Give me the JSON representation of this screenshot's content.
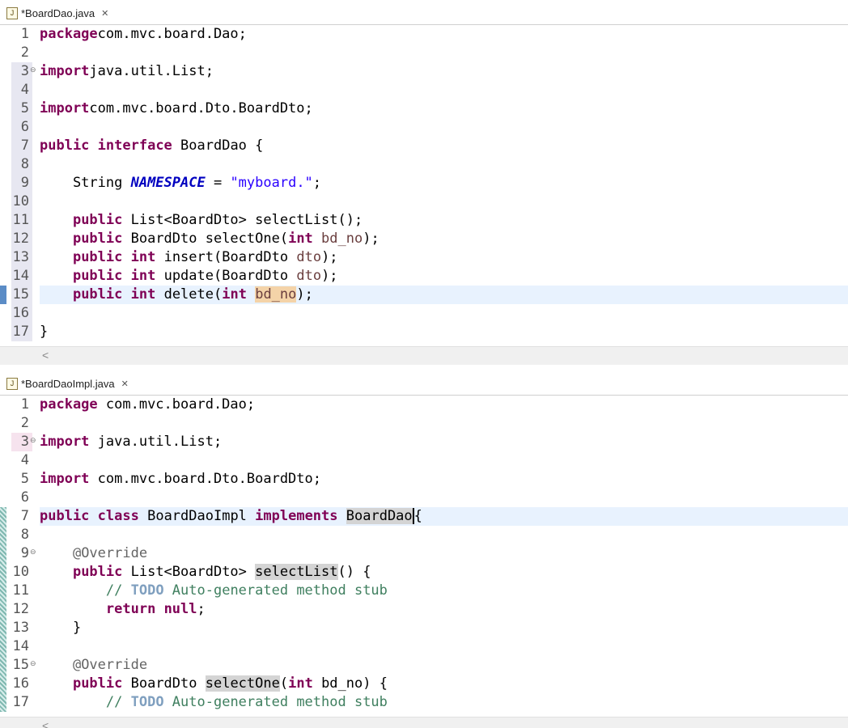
{
  "editors": [
    {
      "tab_label": "*BoardDao.java",
      "lines": [
        {
          "n": "1",
          "segs": [
            [
              "kw",
              "package"
            ],
            [
              "",
              "com.mvc.board.Dao;"
            ]
          ]
        },
        {
          "n": "2",
          "segs": []
        },
        {
          "n": "3",
          "segs": [
            [
              "kw",
              "import"
            ],
            [
              "",
              "java.util.List;"
            ]
          ]
        },
        {
          "n": "4",
          "segs": []
        },
        {
          "n": "5",
          "segs": [
            [
              "kw",
              "import"
            ],
            [
              "",
              "com.mvc.board.Dto.BoardDto;"
            ]
          ]
        },
        {
          "n": "6",
          "segs": []
        },
        {
          "n": "7",
          "segs": [
            [
              "kw",
              "public"
            ],
            [
              "",
              " "
            ],
            [
              "kw",
              "interface"
            ],
            [
              "",
              " BoardDao {"
            ]
          ]
        },
        {
          "n": "8",
          "segs": []
        },
        {
          "n": "9",
          "segs": [
            [
              "",
              "    String "
            ],
            [
              "const",
              "NAMESPACE"
            ],
            [
              "",
              " = "
            ],
            [
              "str",
              "\"myboard.\""
            ],
            [
              "",
              ";"
            ]
          ]
        },
        {
          "n": "10",
          "segs": []
        },
        {
          "n": "11",
          "segs": [
            [
              "",
              "    "
            ],
            [
              "kw",
              "public"
            ],
            [
              "",
              " List<BoardDto> selectList();"
            ]
          ]
        },
        {
          "n": "12",
          "segs": [
            [
              "",
              "    "
            ],
            [
              "kw",
              "public"
            ],
            [
              "",
              " BoardDto selectOne("
            ],
            [
              "kw",
              "int"
            ],
            [
              "",
              " "
            ],
            [
              "param",
              "bd_no"
            ],
            [
              "",
              ");"
            ]
          ]
        },
        {
          "n": "13",
          "segs": [
            [
              "",
              "    "
            ],
            [
              "kw",
              "public"
            ],
            [
              "",
              " "
            ],
            [
              "kw",
              "int"
            ],
            [
              "",
              " insert(BoardDto "
            ],
            [
              "param",
              "dto"
            ],
            [
              "",
              ");"
            ]
          ]
        },
        {
          "n": "14",
          "segs": [
            [
              "",
              "    "
            ],
            [
              "kw",
              "public"
            ],
            [
              "",
              " "
            ],
            [
              "kw",
              "int"
            ],
            [
              "",
              " update(BoardDto "
            ],
            [
              "param",
              "dto"
            ],
            [
              "",
              ");"
            ]
          ]
        },
        {
          "n": "15",
          "segs": [
            [
              "",
              "    "
            ],
            [
              "kw",
              "public"
            ],
            [
              "",
              " "
            ],
            [
              "kw",
              "int"
            ],
            [
              "",
              " delete("
            ],
            [
              "kw",
              "int"
            ],
            [
              "",
              " "
            ],
            [
              "param occp",
              "bd_no"
            ],
            [
              "",
              ");"
            ]
          ]
        },
        {
          "n": "16",
          "segs": []
        },
        {
          "n": "17",
          "segs": [
            [
              "",
              "}"
            ]
          ]
        }
      ]
    },
    {
      "tab_label": "*BoardDaoImpl.java",
      "lines": [
        {
          "n": "1",
          "segs": [
            [
              "kw",
              "package"
            ],
            [
              "",
              " com.mvc.board.Dao;"
            ]
          ]
        },
        {
          "n": "2",
          "segs": []
        },
        {
          "n": "3",
          "segs": [
            [
              "kw",
              "import"
            ],
            [
              "",
              " java.util.List;"
            ]
          ]
        },
        {
          "n": "4",
          "segs": []
        },
        {
          "n": "5",
          "segs": [
            [
              "kw",
              "import"
            ],
            [
              "",
              " com.mvc.board.Dto.BoardDto;"
            ]
          ]
        },
        {
          "n": "6",
          "segs": []
        },
        {
          "n": "7",
          "segs": [
            [
              "kw",
              "public"
            ],
            [
              "",
              " "
            ],
            [
              "kw",
              "class"
            ],
            [
              "",
              " BoardDaoImpl "
            ],
            [
              "kw",
              "implements"
            ],
            [
              "",
              " "
            ],
            [
              "occ caret",
              "BoardDao"
            ],
            [
              "",
              "{"
            ]
          ]
        },
        {
          "n": "8",
          "segs": []
        },
        {
          "n": "9",
          "segs": [
            [
              "",
              "    "
            ],
            [
              "ann",
              "@Override"
            ]
          ]
        },
        {
          "n": "10",
          "segs": [
            [
              "",
              "    "
            ],
            [
              "kw",
              "public"
            ],
            [
              "",
              " List<BoardDto> "
            ],
            [
              "occ",
              "selectList"
            ],
            [
              "",
              "() {"
            ]
          ]
        },
        {
          "n": "11",
          "segs": [
            [
              "",
              "        "
            ],
            [
              "cmt",
              "// "
            ],
            [
              "todo",
              "TODO"
            ],
            [
              "cmt",
              " Auto-generated method stub"
            ]
          ]
        },
        {
          "n": "12",
          "segs": [
            [
              "",
              "        "
            ],
            [
              "kw",
              "return"
            ],
            [
              "",
              " "
            ],
            [
              "kw",
              "null"
            ],
            [
              "",
              ";"
            ]
          ]
        },
        {
          "n": "13",
          "segs": [
            [
              "",
              "    }"
            ]
          ]
        },
        {
          "n": "14",
          "segs": []
        },
        {
          "n": "15",
          "segs": [
            [
              "",
              "    "
            ],
            [
              "ann",
              "@Override"
            ]
          ]
        },
        {
          "n": "16",
          "segs": [
            [
              "",
              "    "
            ],
            [
              "kw",
              "public"
            ],
            [
              "",
              " BoardDto "
            ],
            [
              "occ",
              "selectOne"
            ],
            [
              "",
              "("
            ],
            [
              "kw",
              "int"
            ],
            [
              "",
              " bd_no) {"
            ]
          ]
        },
        {
          "n": "17",
          "segs": [
            [
              "",
              "        "
            ],
            [
              "cmt",
              "// "
            ],
            [
              "todo",
              "TODO"
            ],
            [
              "cmt",
              " Auto-generated method stub"
            ]
          ]
        }
      ]
    }
  ]
}
